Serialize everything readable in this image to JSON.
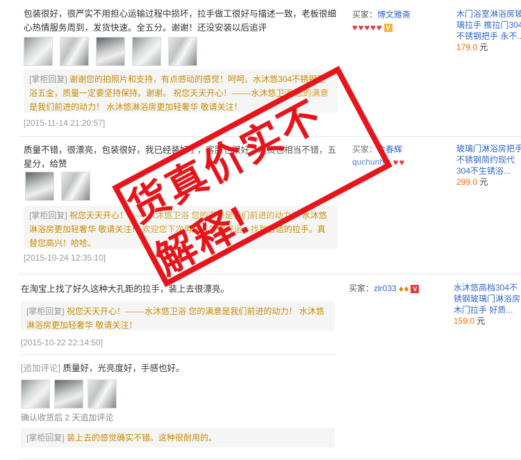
{
  "reviews": [
    {
      "content": "包装很好，很严实不用担心运输过程中损坏，拉手做工很好与描述一致，老板很细心热情服务周到，发货快速。全五分。谢谢！还没安装以后追评",
      "reply_tag": "[掌柜回复]",
      "reply_text": "谢谢您的拍照片和支持，有点感动的感觉！呵呵。水沐悠304不锈钢卫浴五金，质量一定要坚持保持。谢谢。 祝您天天开心！-------水沐悠卫浴 您的满意是我们前进的动力！ 水沐悠淋浴房更加轻奢华 敬请关注！",
      "date": "[2015-11-14 21:20:57]",
      "buyer_label": "买家：",
      "buyer_name": "博文雅斋",
      "product_title": "木门浴室淋浴房玻璃拉手 推拉门304不锈钢把手 永不...",
      "price": "179.0",
      "unit": "元"
    },
    {
      "content": "质量不错，很漂亮，包装很好，我已经装好了，客服也很好，发货也相当不错，五星分，给赞",
      "reply_tag": "[掌柜回复]",
      "reply_text": "祝您天天开心！-------水沐悠卫浴 您的满意是我们前进的动力！ 水沐悠淋浴房更加轻奢华 敬请关注！ 欢迎您下次再来，祝您好运，找到合适的拉手。真替您高兴！哈哈。",
      "date": "[2015-10-24 12:35:10]",
      "buyer_label": "买家：",
      "buyer_name": "俞春辉 quchunhui",
      "product_title": "玻璃门淋浴房把手不锈钢简约现代 304不生锈浴...",
      "price": "299.0",
      "unit": "元"
    },
    {
      "content": "在淘宝上找了好久这种大孔距的拉手，装上去很漂亮。",
      "reply_tag": "[掌柜回复]",
      "reply_text": "祝您天天开心！-------水沐悠卫浴 您的满意是我们前进的动力！ 水沐悠淋浴房更加轻奢华 敬请关注！",
      "date": "[2015-10-22 22:14:50]",
      "add_label": "[追加评论]",
      "add_text": "质量好，光亮度好，手感也好。",
      "add_note": "确认收货后 2 天追加评论",
      "add_reply_text": "装上去的感觉确实不错。这种很耐用的。",
      "buyer_label": "买家：",
      "buyer_name": "zlr033",
      "product_title": "水沐悠高档304不锈钢玻璃门淋浴房木门拉手 好质...",
      "price": "159.0",
      "unit": "元"
    }
  ],
  "stamp_text": "货真价实不解释!",
  "colors": {
    "accent_red": "#e8141b",
    "link_blue": "#3366cc",
    "price_orange": "#ff6600",
    "reply_gold": "#c88b00"
  }
}
